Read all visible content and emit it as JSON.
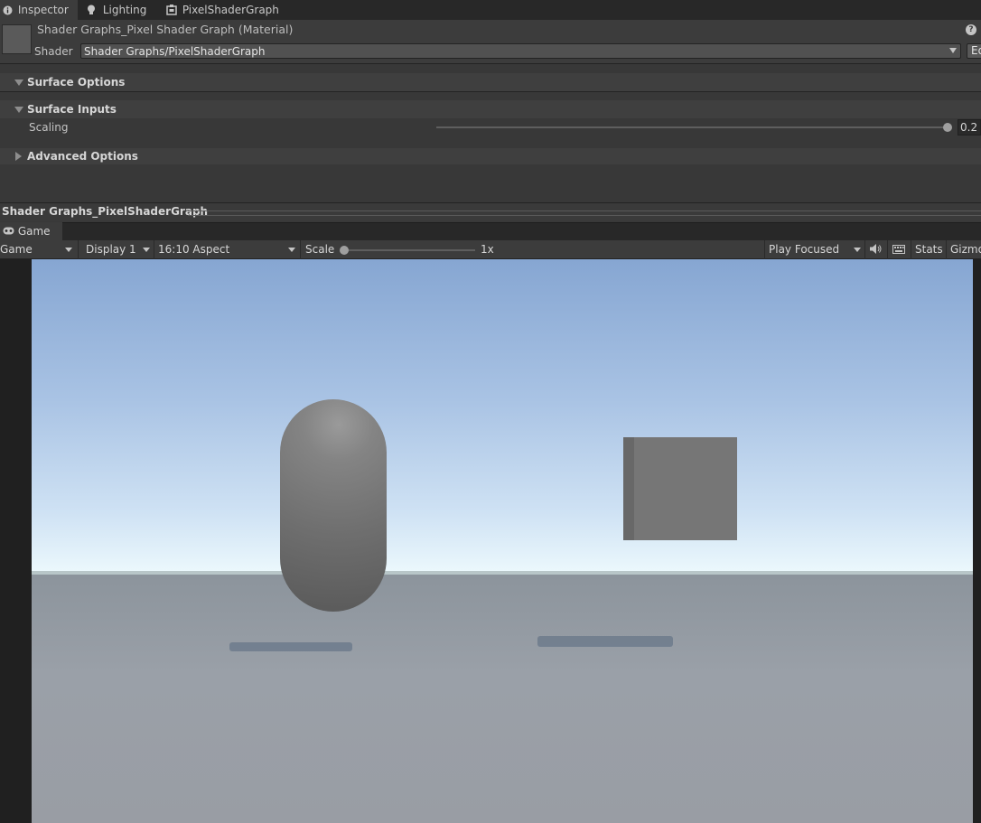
{
  "tabs": {
    "inspector": "Inspector",
    "lighting": "Lighting",
    "shader_graph": "PixelShaderGraph"
  },
  "material": {
    "title": "Shader Graphs_Pixel Shader Graph (Material)",
    "help_glyph": "?",
    "shader_label": "Shader",
    "shader_value": "Shader Graphs/PixelShaderGraph",
    "edit_label": "Ed"
  },
  "sections": {
    "surface_options": "Surface Options",
    "surface_inputs": "Surface Inputs",
    "advanced_options": "Advanced Options"
  },
  "scaling": {
    "label": "Scaling",
    "value": "0.2",
    "fraction": 1.0
  },
  "preview": {
    "title": "Shader Graphs_PixelShaderGraph"
  },
  "game": {
    "tab_label": "Game",
    "view_mode": "Game",
    "display": "Display 1",
    "aspect": "16:10 Aspect",
    "scale_label": "Scale",
    "scale_value": "1x",
    "play_mode": "Play Focused",
    "stats_label": "Stats",
    "gizmos_label": "Gizmo"
  },
  "colors": {
    "panel_bg": "#383838",
    "sky_top": "#86a6d2",
    "ground": "#9aa0a8"
  },
  "icons": [
    "info-icon",
    "lightbulb-icon",
    "shader-graph-icon",
    "help-icon",
    "gamepad-icon",
    "audio-icon",
    "keyboard-icon"
  ]
}
